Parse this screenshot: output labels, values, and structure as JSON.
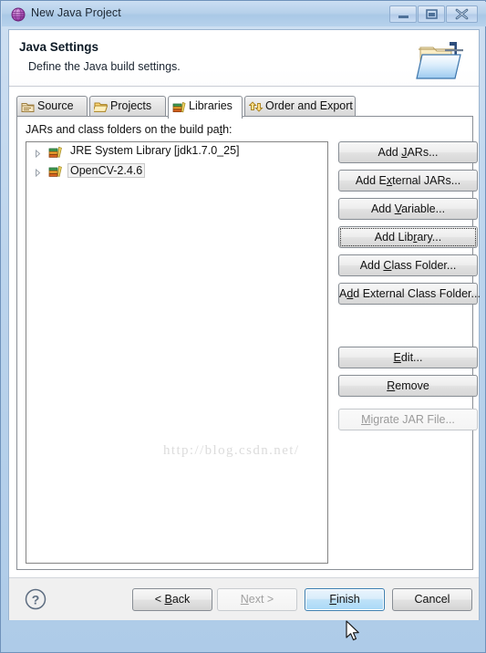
{
  "window": {
    "title": "New Java Project",
    "icon": "java-wizard-icon",
    "controls": [
      {
        "name": "minimize-button",
        "label": "–"
      },
      {
        "name": "maximize-button",
        "label": "□"
      },
      {
        "name": "close-button",
        "label": "✕"
      }
    ]
  },
  "header": {
    "title": "Java Settings",
    "subtitle": "Define the Java build settings.",
    "icon": "java-build-folder-icon"
  },
  "tabs": [
    {
      "label": "Source",
      "icon": "source-folder-icon",
      "active": false
    },
    {
      "label": "Projects",
      "icon": "projects-folder-icon",
      "active": false
    },
    {
      "label": "Libraries",
      "icon": "libraries-books-icon",
      "active": true
    },
    {
      "label": "Order and Export",
      "icon": "order-export-arrows-icon",
      "active": false
    }
  ],
  "libraries_page": {
    "list_label": "JARs and class folders on the build path:",
    "list_label_mnemonic": "t",
    "entries": [
      {
        "label": "JRE System Library [jdk1.7.0_25]",
        "icon": "library-books-icon",
        "expanded": false,
        "selected": false
      },
      {
        "label": "OpenCV-2.4.6",
        "icon": "library-books-icon",
        "expanded": false,
        "selected": true
      }
    ],
    "buttons": [
      {
        "name": "add-jars-button",
        "label": "Add JARs...",
        "mnemonic": "J",
        "enabled": true,
        "focused": false
      },
      {
        "name": "add-external-jars-button",
        "label": "Add External JARs...",
        "mnemonic": "x",
        "enabled": true,
        "focused": false
      },
      {
        "name": "add-variable-button",
        "label": "Add Variable...",
        "mnemonic": "V",
        "enabled": true,
        "focused": false
      },
      {
        "name": "add-library-button",
        "label": "Add Library...",
        "mnemonic": "r",
        "enabled": true,
        "focused": true
      },
      {
        "name": "add-class-folder-button",
        "label": "Add Class Folder...",
        "mnemonic": "C",
        "enabled": true,
        "focused": false
      },
      {
        "name": "add-external-class-folder-button",
        "label": "Add External Class Folder...",
        "mnemonic": "d",
        "enabled": true,
        "focused": false
      },
      {
        "name": "edit-button",
        "label": "Edit...",
        "mnemonic": "E",
        "enabled": true,
        "focused": false
      },
      {
        "name": "remove-button",
        "label": "Remove",
        "mnemonic": "R",
        "enabled": true,
        "focused": false
      },
      {
        "name": "migrate-jar-file-button",
        "label": "Migrate JAR File...",
        "mnemonic": "M",
        "enabled": false,
        "focused": false
      }
    ]
  },
  "watermark": "http://blog.csdn.net/",
  "bottom_bar": {
    "help_icon": "help-question-icon",
    "buttons": [
      {
        "name": "back-button",
        "label": "< Back",
        "enabled": true,
        "primary": false
      },
      {
        "name": "next-button",
        "label": "Next >",
        "enabled": false,
        "primary": false
      },
      {
        "name": "finish-button",
        "label": "Finish",
        "enabled": true,
        "primary": true
      },
      {
        "name": "cancel-button",
        "label": "Cancel",
        "enabled": true,
        "primary": false
      }
    ]
  },
  "colors": {
    "titlebar": "#aecbe8",
    "window_border": "#6f92bb",
    "primary_button_border": "#3c7fb1",
    "watermark": "#dcdcdc",
    "disabled_text": "#9a9a9a"
  }
}
